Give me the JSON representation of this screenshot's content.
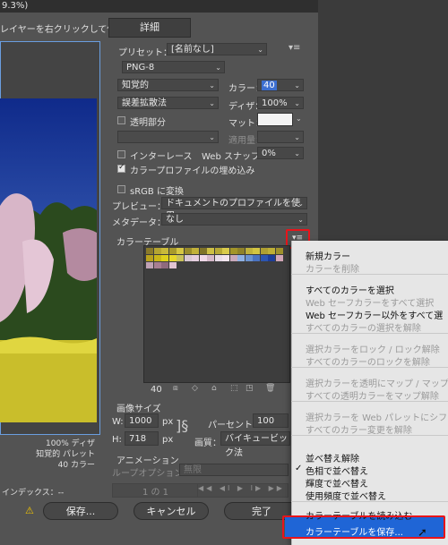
{
  "window": {
    "title_fragment": "9.3%)",
    "hint": "レイヤーを右クリックして使用。",
    "tab_details": "詳細"
  },
  "preset": {
    "label": "プリセット：",
    "value": "[名前なし]",
    "format": "PNG-8"
  },
  "settings": {
    "reduction": "知覚的",
    "colors_label": "カラー：",
    "colors_value": "40",
    "dither_algo": "誤差拡散法",
    "dither_label": "ディザ：",
    "dither_value": "100%",
    "transparency": "透明部分",
    "matte_label": "マット：",
    "amount_label": "適用量：",
    "interlaced": "インターレース",
    "websnap_label": "Web スナップ：",
    "websnap_value": "0%",
    "embed_profile": "カラープロファイルの埋め込み",
    "srgb": "sRGB に変換",
    "preview_label": "プレビュー：",
    "preview_value": "ドキュメントのプロファイルを使用",
    "metadata_label": "メタデータ：",
    "metadata_value": "なし"
  },
  "color_table": {
    "title": "カラーテーブル",
    "count": "40",
    "swatches": [
      "#8a7a2a",
      "#b5a531",
      "#c9b93a",
      "#a89a2c",
      "#d6c743",
      "#9b8d2b",
      "#c2b13a",
      "#7f7328",
      "#cdbf45",
      "#b7a936",
      "#d9cb4c",
      "#a39529",
      "#8f8229",
      "#c0b23b",
      "#d3c542",
      "#ae9f31",
      "#beaf36",
      "#9e902c",
      "#b9a21d",
      "#cab617",
      "#ded01c",
      "#e7d82a",
      "#c9c25a",
      "#d8c7d4",
      "#e6cfe0",
      "#f0d8e8",
      "#d5b8c9",
      "#e8dce9",
      "#f2e5ef",
      "#c9a9bb",
      "#8fb1e3",
      "#6b93d0",
      "#4a73c1",
      "#2c55b0",
      "#1d3d98",
      "#d2a6b7",
      "#bfa2b4",
      "#a87f93",
      "#8f6a7d",
      "#e1c3d1"
    ]
  },
  "image_size": {
    "title": "画像サイズ",
    "w_label": "W:",
    "w_value": "1000",
    "h_label": "H:",
    "h_value": "718",
    "unit": "px",
    "percent_label": "パーセント：",
    "percent_value": "100",
    "quality_label": "画質：",
    "quality_value": "バイキュービック法"
  },
  "animation": {
    "title": "アニメーション",
    "loop_label": "ループオプション：",
    "loop_value": "無限",
    "frame": "1 の 1"
  },
  "preview_info": {
    "dither": "100% ディザ",
    "palette": "知覚的 パレット",
    "colors": "40 カラー",
    "index": "インデックス：--"
  },
  "buttons": {
    "save": "保存...",
    "cancel": "キャンセル",
    "done": "完了"
  },
  "menu": {
    "items": [
      {
        "label": "新規カラー",
        "enabled": true
      },
      {
        "label": "カラーを削除",
        "enabled": false
      },
      {
        "label": "すべてのカラーを選択",
        "enabled": true
      },
      {
        "label": "Web セーフカラーをすべて選択",
        "enabled": false
      },
      {
        "label": "Web セーフカラー以外をすべて選",
        "enabled": true
      },
      {
        "label": "すべてのカラーの選択を解除",
        "enabled": false
      },
      {
        "label": "選択カラーをロック / ロック解除",
        "enabled": false
      },
      {
        "label": "すべてのカラーのロックを解除",
        "enabled": false
      },
      {
        "label": "選択カラーを透明にマップ / マップ",
        "enabled": false
      },
      {
        "label": "すべての透明カラーをマップ解除",
        "enabled": false
      },
      {
        "label": "選択カラーを Web パレットにシフ",
        "enabled": false
      },
      {
        "label": "すべてのカラー変更を解除",
        "enabled": false
      },
      {
        "label": "並べ替え解除",
        "enabled": true
      },
      {
        "label": "色相で並べ替え",
        "enabled": true,
        "checked": true
      },
      {
        "label": "輝度で並べ替え",
        "enabled": true
      },
      {
        "label": "使用頻度で並べ替え",
        "enabled": true
      },
      {
        "label": "カラーテーブルを読み込む",
        "enabled": true
      },
      {
        "label": "カラーテーブルを保存...",
        "enabled": true,
        "highlighted": true
      }
    ]
  },
  "colors": {
    "highlight": "#1f65d6",
    "annotation_red": "#e8141a",
    "dialog_bg": "#535353",
    "menu_bg": "#e6e6e6"
  }
}
